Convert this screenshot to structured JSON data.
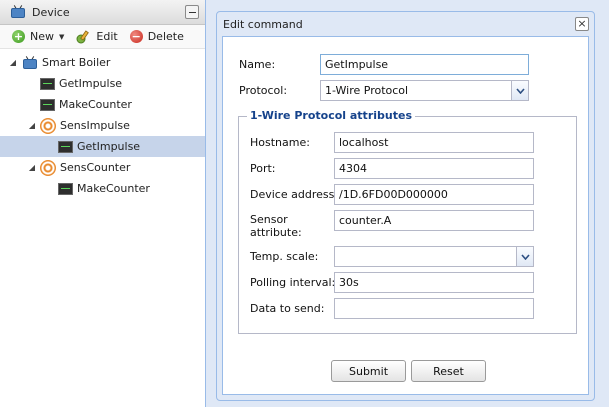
{
  "left_panel": {
    "title": "Device",
    "toolbar": {
      "new_label": "New",
      "edit_label": "Edit",
      "delete_label": "Delete"
    },
    "tree": [
      {
        "label": "Smart Boiler",
        "icon": "tv-icon"
      },
      {
        "label": "GetImpulse",
        "icon": "monitor-icon"
      },
      {
        "label": "MakeCounter",
        "icon": "monitor-icon"
      },
      {
        "label": "SensImpulse",
        "icon": "sensor-icon"
      },
      {
        "label": "GetImpulse",
        "icon": "monitor-icon",
        "selected": true
      },
      {
        "label": "SensCounter",
        "icon": "sensor-icon"
      },
      {
        "label": "MakeCounter",
        "icon": "monitor-icon"
      }
    ]
  },
  "dialog": {
    "title": "Edit command",
    "name_label": "Name:",
    "name_value": "GetImpulse",
    "protocol_label": "Protocol:",
    "protocol_value": "1-Wire Protocol",
    "fieldset_title": "1-Wire Protocol attributes",
    "fields": {
      "hostname_label": "Hostname:",
      "hostname_value": "localhost",
      "port_label": "Port:",
      "port_value": "4304",
      "device_address_label": "Device address:",
      "device_address_value": "/1D.6FD00D000000",
      "sensor_attribute_label_1": "Sensor",
      "sensor_attribute_label_2": "attribute:",
      "sensor_attribute_value": "counter.A",
      "temp_scale_label": "Temp. scale:",
      "temp_scale_value": "",
      "polling_interval_label": "Polling interval:",
      "polling_interval_value": "30s",
      "data_to_send_label": "Data to send:",
      "data_to_send_value": ""
    },
    "submit_label": "Submit",
    "reset_label": "Reset"
  },
  "colors": {
    "accent": "#15428b",
    "border": "#99bbe8",
    "background": "#dfe8f6",
    "selection": "#c6d4ea"
  }
}
